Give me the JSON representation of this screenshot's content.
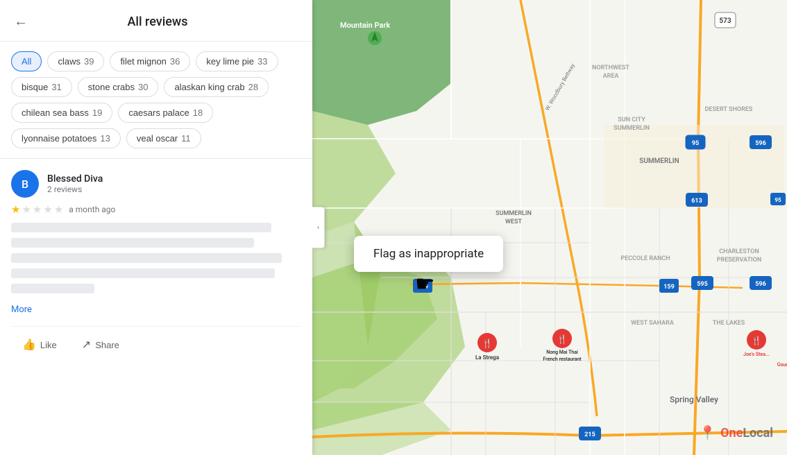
{
  "header": {
    "back_label": "←",
    "title": "All reviews"
  },
  "chips": [
    {
      "label": "All",
      "count": "",
      "active": true
    },
    {
      "label": "claws",
      "count": "39",
      "active": false
    },
    {
      "label": "filet mignon",
      "count": "36",
      "active": false
    },
    {
      "label": "key lime pie",
      "count": "33",
      "active": false
    },
    {
      "label": "bisque",
      "count": "31",
      "active": false
    },
    {
      "label": "stone crabs",
      "count": "30",
      "active": false
    },
    {
      "label": "alaskan king crab",
      "count": "28",
      "active": false
    },
    {
      "label": "chilean sea bass",
      "count": "19",
      "active": false
    },
    {
      "label": "caesars palace",
      "count": "18",
      "active": false
    },
    {
      "label": "lyonnaise potatoes",
      "count": "13",
      "active": false
    },
    {
      "label": "veal oscar",
      "count": "11",
      "active": false
    }
  ],
  "review": {
    "avatar_letter": "B",
    "reviewer_name": "Blessed Diva",
    "reviewer_meta": "2 reviews",
    "rating": 1,
    "max_rating": 5,
    "time_ago": "a month ago",
    "lines": [
      375,
      350,
      390,
      380,
      120
    ],
    "more_label": "More"
  },
  "actions": {
    "like_label": "Like",
    "share_label": "Share"
  },
  "flag_tooltip": {
    "label": "Flag as inappropriate"
  },
  "map": {
    "collapse_icon": "‹",
    "mountain_park_label": "Mountain Park",
    "summerlin_label": "SUMMERLIN",
    "summerlin_west_label": "SUMMERLIN WEST",
    "sun_city_label": "SUN CITY SUMMERLIN",
    "desert_shores_label": "DESERT SHORES",
    "peccole_ranch_label": "PECCOLE RANCH",
    "west_sahara_label": "WEST SAHARA",
    "the_lakes_label": "THE LAKES",
    "spring_valley_label": "Spring Valley",
    "charleston_label": "CHARLESTON PRESERVATION",
    "northwest_label": "NORTHWEST AREA",
    "road_573": "573",
    "road_95": "95",
    "road_596": "596",
    "road_613": "613",
    "road_595": "595",
    "road_159": "159",
    "road_215": "215",
    "restaurant1": "La Strega",
    "restaurant2": "Nong Mai Thai French restaurant",
    "restaurant3": "Joe's Stea...",
    "restaurant4": "Gour...",
    "brand_icon": "📍",
    "brand_name": "OneLocal"
  }
}
